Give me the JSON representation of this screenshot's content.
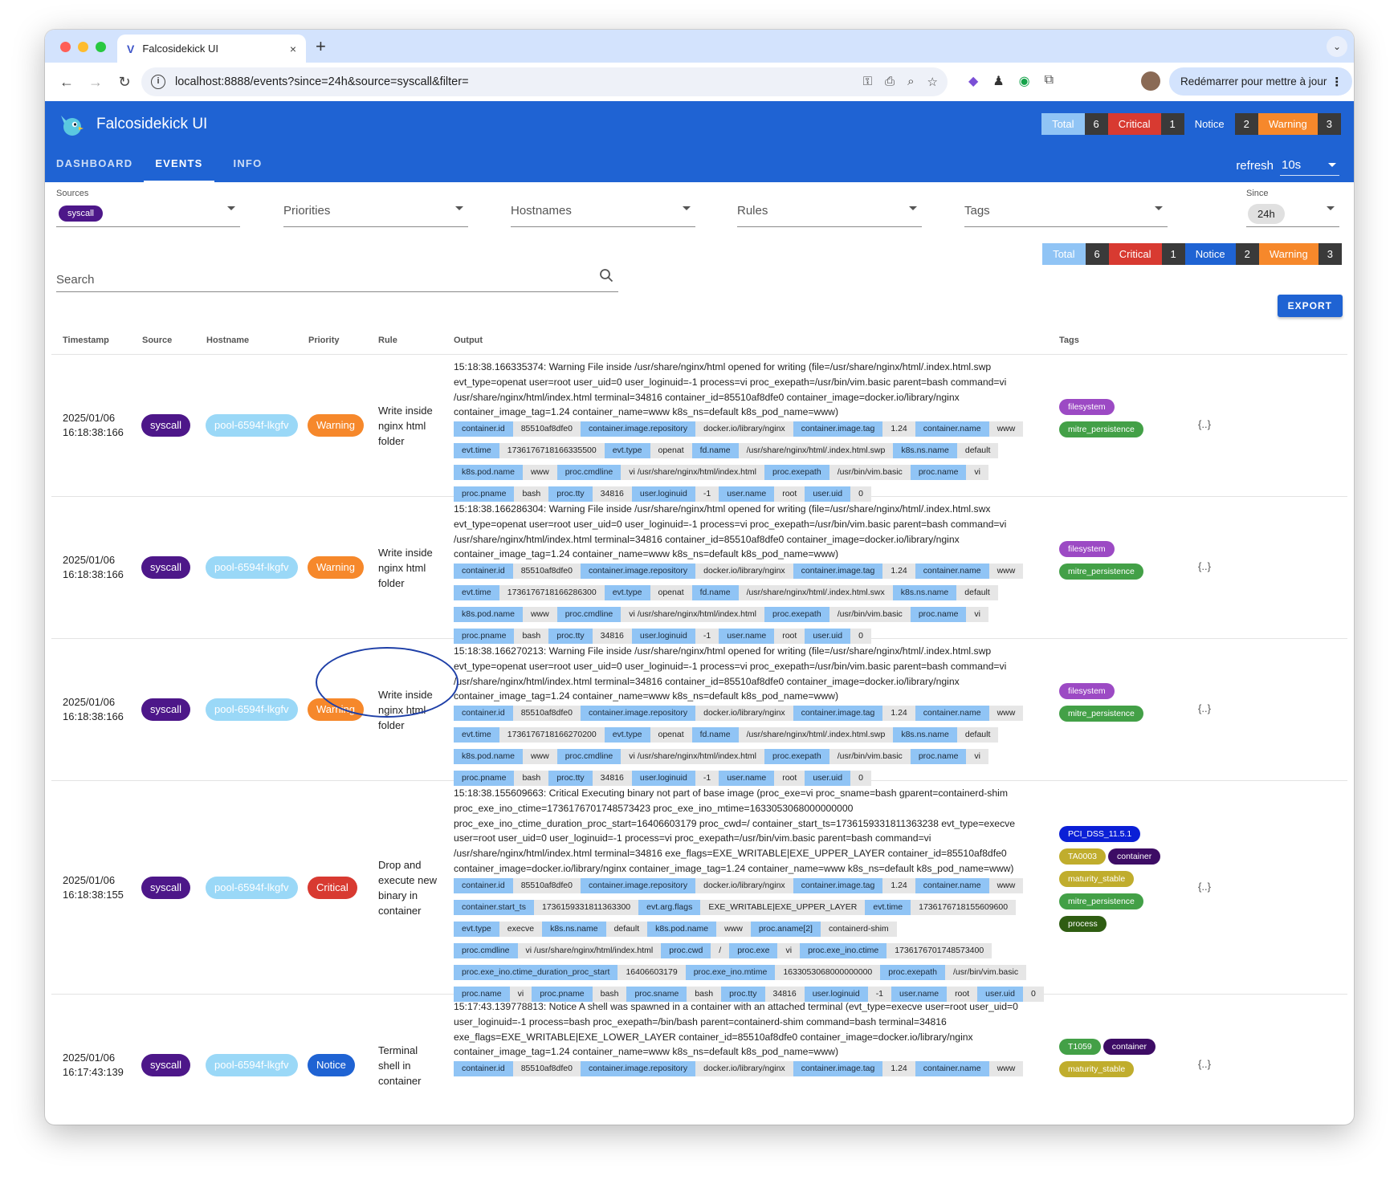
{
  "browser": {
    "tab_title": "Falcosidekick UI",
    "tab_close": "×",
    "new_tab": "+",
    "url": "localhost:8888/events?since=24h&source=syscall&filter=",
    "update_button": "Redémarrer pour mettre à jour"
  },
  "app": {
    "title": "Falcosidekick UI",
    "nav": [
      "DASHBOARD",
      "EVENTS",
      "INFO"
    ],
    "refresh_label": "refresh",
    "refresh_value": "10s",
    "header_counts": {
      "total_label": "Total",
      "total": "6",
      "critical_label": "Critical",
      "critical": "1",
      "notice_label": "Notice",
      "notice": "2",
      "warning_label": "Warning",
      "warning": "3"
    }
  },
  "filters": {
    "sources_label": "Sources",
    "sources_chip": "syscall",
    "priorities": "Priorities",
    "hostnames": "Hostnames",
    "rules": "Rules",
    "tags": "Tags",
    "since_label": "Since",
    "since_chip": "24h",
    "search_placeholder": "Search"
  },
  "counts": {
    "total_label": "Total",
    "total": "6",
    "critical_label": "Critical",
    "critical": "1",
    "notice_label": "Notice",
    "notice": "2",
    "warning_label": "Warning",
    "warning": "3"
  },
  "export_label": "EXPORT",
  "table": {
    "headers": [
      "Timestamp",
      "Source",
      "Hostname",
      "Priority",
      "Rule",
      "Output",
      "Tags"
    ],
    "json_icon": "{..}",
    "rows": [
      {
        "date": "2025/01/06",
        "time": "16:18:38:166",
        "source": "syscall",
        "hostname": "pool-6594f-lkgfv",
        "priority": "Warning",
        "rule": "Write inside nginx html folder",
        "output": "15:18:38.166335374: Warning File inside /usr/share/nginx/html opened for writing (file=/usr/share/nginx/html/.index.html.swp evt_type=openat user=root user_uid=0 user_loginuid=-1 process=vi proc_exepath=/usr/bin/vim.basic parent=bash command=vi /usr/share/nginx/html/index.html terminal=34816 container_id=85510af8dfe0 container_image=docker.io/library/nginx container_image_tag=1.24 container_name=www k8s_ns=default k8s_pod_name=www)",
        "fields": [
          [
            "container.id",
            "85510af8dfe0"
          ],
          [
            "container.image.repository",
            "docker.io/library/nginx"
          ],
          [
            "container.image.tag",
            "1.24"
          ],
          [
            "container.name",
            "www"
          ],
          [
            "evt.time",
            "1736176718166335500"
          ],
          [
            "evt.type",
            "openat"
          ],
          [
            "fd.name",
            "/usr/share/nginx/html/.index.html.swp"
          ],
          [
            "k8s.ns.name",
            "default"
          ],
          [
            "k8s.pod.name",
            "www"
          ],
          [
            "proc.cmdline",
            "vi /usr/share/nginx/html/index.html"
          ],
          [
            "proc.exepath",
            "/usr/bin/vim.basic"
          ],
          [
            "proc.name",
            "vi"
          ],
          [
            "proc.pname",
            "bash"
          ],
          [
            "proc.tty",
            "34816"
          ],
          [
            "user.loginuid",
            "-1"
          ],
          [
            "user.name",
            "root"
          ],
          [
            "user.uid",
            "0"
          ]
        ],
        "tags": [
          [
            "filesystem",
            "purple"
          ],
          [
            "mitre_persistence",
            "green"
          ]
        ]
      },
      {
        "date": "2025/01/06",
        "time": "16:18:38:166",
        "source": "syscall",
        "hostname": "pool-6594f-lkgfv",
        "priority": "Warning",
        "rule": "Write inside nginx html folder",
        "output": "15:18:38.166286304: Warning File inside /usr/share/nginx/html opened for writing (file=/usr/share/nginx/html/.index.html.swx evt_type=openat user=root user_uid=0 user_loginuid=-1 process=vi proc_exepath=/usr/bin/vim.basic parent=bash command=vi /usr/share/nginx/html/index.html terminal=34816 container_id=85510af8dfe0 container_image=docker.io/library/nginx container_image_tag=1.24 container_name=www k8s_ns=default k8s_pod_name=www)",
        "fields": [
          [
            "container.id",
            "85510af8dfe0"
          ],
          [
            "container.image.repository",
            "docker.io/library/nginx"
          ],
          [
            "container.image.tag",
            "1.24"
          ],
          [
            "container.name",
            "www"
          ],
          [
            "evt.time",
            "1736176718166286300"
          ],
          [
            "evt.type",
            "openat"
          ],
          [
            "fd.name",
            "/usr/share/nginx/html/.index.html.swx"
          ],
          [
            "k8s.ns.name",
            "default"
          ],
          [
            "k8s.pod.name",
            "www"
          ],
          [
            "proc.cmdline",
            "vi /usr/share/nginx/html/index.html"
          ],
          [
            "proc.exepath",
            "/usr/bin/vim.basic"
          ],
          [
            "proc.name",
            "vi"
          ],
          [
            "proc.pname",
            "bash"
          ],
          [
            "proc.tty",
            "34816"
          ],
          [
            "user.loginuid",
            "-1"
          ],
          [
            "user.name",
            "root"
          ],
          [
            "user.uid",
            "0"
          ]
        ],
        "tags": [
          [
            "filesystem",
            "purple"
          ],
          [
            "mitre_persistence",
            "green"
          ]
        ]
      },
      {
        "date": "2025/01/06",
        "time": "16:18:38:166",
        "source": "syscall",
        "hostname": "pool-6594f-lkgfv",
        "priority": "Warning",
        "rule": "Write inside nginx html folder",
        "output": "15:18:38.166270213: Warning File inside /usr/share/nginx/html opened for writing (file=/usr/share/nginx/html/.index.html.swp evt_type=openat user=root user_uid=0 user_loginuid=-1 process=vi proc_exepath=/usr/bin/vim.basic parent=bash command=vi /usr/share/nginx/html/index.html terminal=34816 container_id=85510af8dfe0 container_image=docker.io/library/nginx container_image_tag=1.24 container_name=www k8s_ns=default k8s_pod_name=www)",
        "fields": [
          [
            "container.id",
            "85510af8dfe0"
          ],
          [
            "container.image.repository",
            "docker.io/library/nginx"
          ],
          [
            "container.image.tag",
            "1.24"
          ],
          [
            "container.name",
            "www"
          ],
          [
            "evt.time",
            "1736176718166270200"
          ],
          [
            "evt.type",
            "openat"
          ],
          [
            "fd.name",
            "/usr/share/nginx/html/.index.html.swp"
          ],
          [
            "k8s.ns.name",
            "default"
          ],
          [
            "k8s.pod.name",
            "www"
          ],
          [
            "proc.cmdline",
            "vi /usr/share/nginx/html/index.html"
          ],
          [
            "proc.exepath",
            "/usr/bin/vim.basic"
          ],
          [
            "proc.name",
            "vi"
          ],
          [
            "proc.pname",
            "bash"
          ],
          [
            "proc.tty",
            "34816"
          ],
          [
            "user.loginuid",
            "-1"
          ],
          [
            "user.name",
            "root"
          ],
          [
            "user.uid",
            "0"
          ]
        ],
        "tags": [
          [
            "filesystem",
            "purple"
          ],
          [
            "mitre_persistence",
            "green"
          ]
        ]
      },
      {
        "date": "2025/01/06",
        "time": "16:18:38:155",
        "source": "syscall",
        "hostname": "pool-6594f-lkgfv",
        "priority": "Critical",
        "rule": "Drop and execute new binary in container",
        "output": "15:18:38.155609663: Critical Executing binary not part of base image (proc_exe=vi proc_sname=bash gparent=containerd-shim proc_exe_ino_ctime=1736176701748573423 proc_exe_ino_mtime=1633053068000000000 proc_exe_ino_ctime_duration_proc_start=16406603179 proc_cwd=/ container_start_ts=1736159331811363238 evt_type=execve user=root user_uid=0 user_loginuid=-1 process=vi proc_exepath=/usr/bin/vim.basic parent=bash command=vi /usr/share/nginx/html/index.html terminal=34816 exe_flags=EXE_WRITABLE|EXE_UPPER_LAYER container_id=85510af8dfe0 container_image=docker.io/library/nginx container_image_tag=1.24 container_name=www k8s_ns=default k8s_pod_name=www)",
        "fields": [
          [
            "container.id",
            "85510af8dfe0"
          ],
          [
            "container.image.repository",
            "docker.io/library/nginx"
          ],
          [
            "container.image.tag",
            "1.24"
          ],
          [
            "container.name",
            "www"
          ],
          [
            "container.start_ts",
            "1736159331811363300"
          ],
          [
            "evt.arg.flags",
            "EXE_WRITABLE|EXE_UPPER_LAYER"
          ],
          [
            "evt.time",
            "1736176718155609600"
          ],
          [
            "evt.type",
            "execve"
          ],
          [
            "k8s.ns.name",
            "default"
          ],
          [
            "k8s.pod.name",
            "www"
          ],
          [
            "proc.aname[2]",
            "containerd-shim"
          ],
          [
            "proc.cmdline",
            "vi /usr/share/nginx/html/index.html"
          ],
          [
            "proc.cwd",
            "/"
          ],
          [
            "proc.exe",
            "vi"
          ],
          [
            "proc.exe_ino.ctime",
            "1736176701748573400"
          ],
          [
            "proc.exe_ino.ctime_duration_proc_start",
            "16406603179"
          ],
          [
            "proc.exe_ino.mtime",
            "1633053068000000000"
          ],
          [
            "proc.exepath",
            "/usr/bin/vim.basic"
          ],
          [
            "proc.name",
            "vi"
          ],
          [
            "proc.pname",
            "bash"
          ],
          [
            "proc.sname",
            "bash"
          ],
          [
            "proc.tty",
            "34816"
          ],
          [
            "user.loginuid",
            "-1"
          ],
          [
            "user.name",
            "root"
          ],
          [
            "user.uid",
            "0"
          ]
        ],
        "tags": [
          [
            "PCI_DSS_11.5.1",
            "navy"
          ],
          [
            "TA0003",
            "olive"
          ],
          [
            "container",
            "dpurple"
          ],
          [
            "maturity_stable",
            "olive"
          ],
          [
            "mitre_persistence",
            "green"
          ],
          [
            "process",
            "dgreen"
          ]
        ]
      },
      {
        "date": "2025/01/06",
        "time": "16:17:43:139",
        "source": "syscall",
        "hostname": "pool-6594f-lkgfv",
        "priority": "Notice",
        "rule": "Terminal shell in container",
        "output": "15:17:43.139778813: Notice A shell was spawned in a container with an attached terminal (evt_type=execve user=root user_uid=0 user_loginuid=-1 process=bash proc_exepath=/bin/bash parent=containerd-shim command=bash terminal=34816 exe_flags=EXE_WRITABLE|EXE_LOWER_LAYER container_id=85510af8dfe0 container_image=docker.io/library/nginx container_image_tag=1.24 container_name=www k8s_ns=default k8s_pod_name=www)",
        "fields": [
          [
            "container.id",
            "85510af8dfe0"
          ],
          [
            "container.image.repository",
            "docker.io/library/nginx"
          ],
          [
            "container.image.tag",
            "1.24"
          ],
          [
            "container.name",
            "www"
          ]
        ],
        "tags": [
          [
            "T1059",
            "green"
          ],
          [
            "container",
            "dpurple"
          ],
          [
            "maturity_stable",
            "olive"
          ]
        ]
      }
    ]
  }
}
